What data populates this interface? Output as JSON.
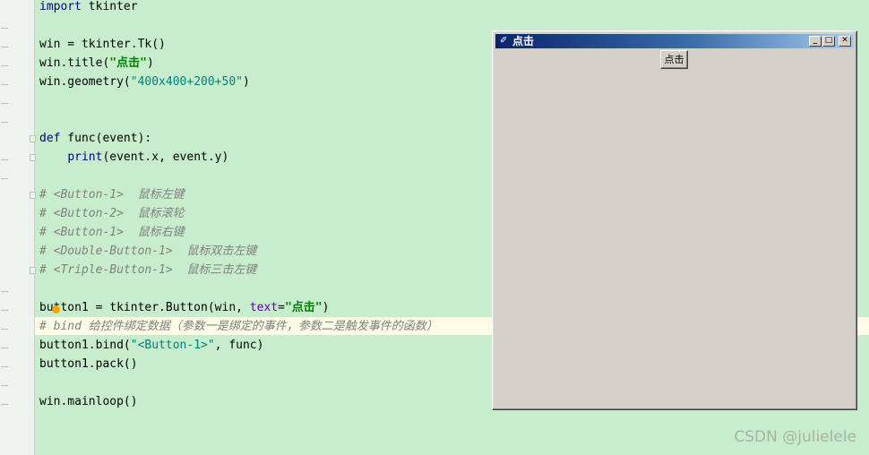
{
  "code": {
    "l1_kw": "import",
    "l1_rest": " tkinter",
    "l3": "win = tkinter.Tk()",
    "l4_a": "win.title(",
    "l4_str": "\"点击\"",
    "l4_b": ")",
    "l5_a": "win.geometry(",
    "l5_str": "\"400x400+200+50\"",
    "l5_b": ")",
    "l8_kw": "def",
    "l8_rest": " func(event):",
    "l9_indent": "    ",
    "l9_bi": "print",
    "l9_rest": "(event.x, event.y)",
    "c1": "# <Button-1>  鼠标左键",
    "c2": "# <Button-2>  鼠标滚轮",
    "c3": "# <Button-1>  鼠标右键",
    "c4": "# <Double-Button-1>  鼠标双击左键",
    "c5": "# <Triple-Button-1>  鼠标三击左键",
    "l17_a": "button1 = tkinter.Button(win, ",
    "l17_param": "text",
    "l17_eq": "=",
    "l17_str": "\"点击\"",
    "l17_b": ")",
    "c6": "# bind 给控件绑定数据（参数一是绑定的事件，参数二是触发事件的函数）",
    "l19_a": "button1.bind(",
    "l19_str": "\"<Button-1>\"",
    "l19_b": ", func)",
    "l20": "button1.pack()",
    "l22": "win.mainloop()"
  },
  "tk_window": {
    "title": "点击",
    "button_label": "点击",
    "min_glyph": "_",
    "max_glyph": "□",
    "close_glyph": "✕",
    "icon_glyph": "✐"
  },
  "watermark": "CSDN @julielele",
  "icons": [
    "tk-feather-icon",
    "minimize-icon",
    "maximize-icon",
    "close-icon"
  ],
  "colors": {
    "editor_bg": "#c7edcc",
    "keyword": "#000080",
    "string": "#008080",
    "comment": "#808080",
    "titlebar_start": "#0a246a",
    "titlebar_end": "#a6caf0",
    "window_bg": "#d4d0c8"
  }
}
